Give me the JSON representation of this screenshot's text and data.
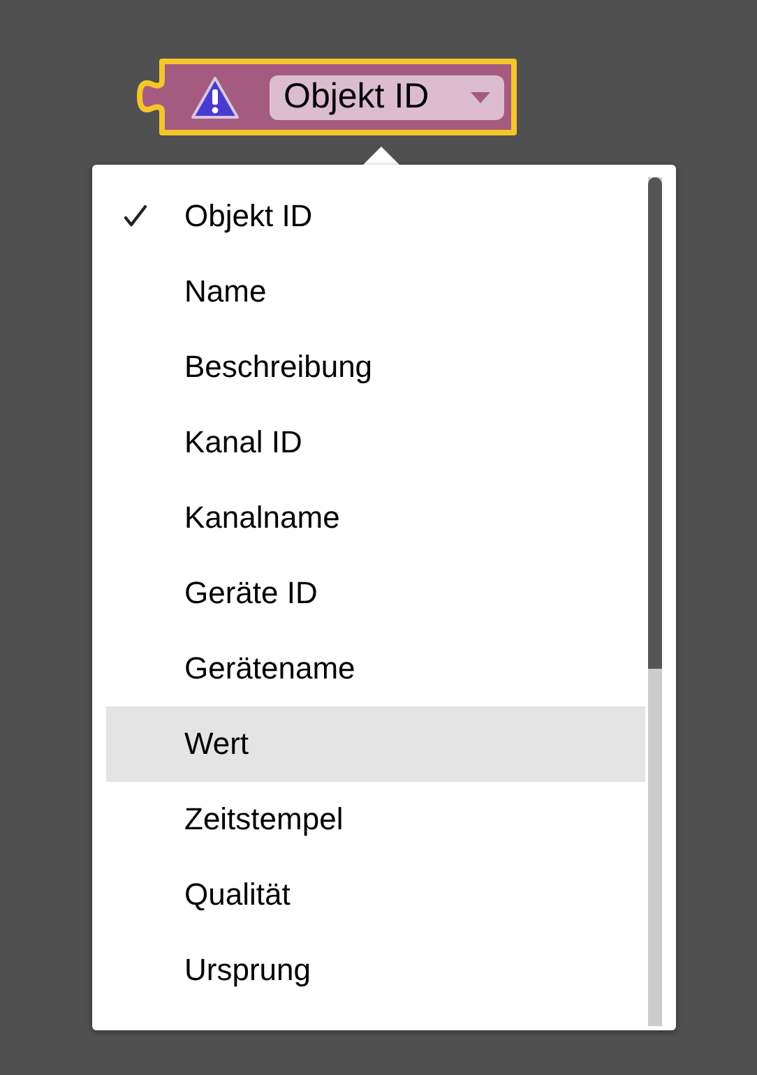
{
  "block": {
    "field": {
      "value": "Objekt ID"
    }
  },
  "menu": {
    "items": [
      {
        "label": "Objekt ID",
        "selected": true,
        "highlighted": false
      },
      {
        "label": "Name",
        "selected": false,
        "highlighted": false
      },
      {
        "label": "Beschreibung",
        "selected": false,
        "highlighted": false
      },
      {
        "label": "Kanal ID",
        "selected": false,
        "highlighted": false
      },
      {
        "label": "Kanalname",
        "selected": false,
        "highlighted": false
      },
      {
        "label": "Geräte ID",
        "selected": false,
        "highlighted": false
      },
      {
        "label": "Gerätename",
        "selected": false,
        "highlighted": false
      },
      {
        "label": "Wert",
        "selected": false,
        "highlighted": true
      },
      {
        "label": "Zeitstempel",
        "selected": false,
        "highlighted": false
      },
      {
        "label": "Qualität",
        "selected": false,
        "highlighted": false
      },
      {
        "label": "Ursprung",
        "selected": false,
        "highlighted": false
      }
    ]
  }
}
